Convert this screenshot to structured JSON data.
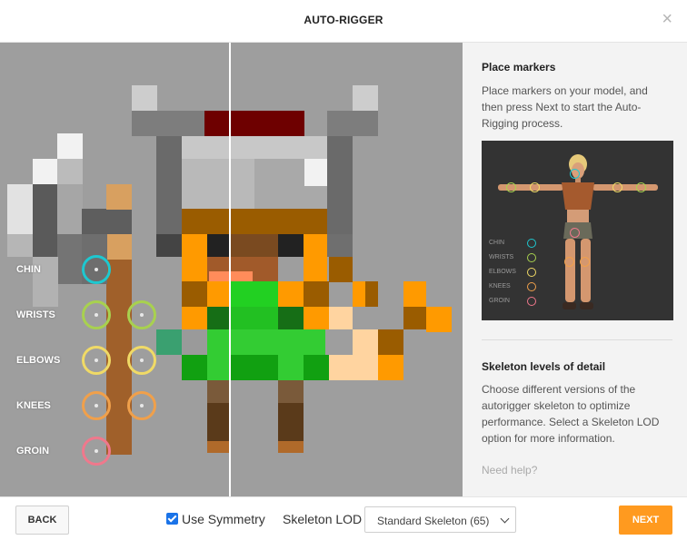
{
  "title": "AUTO-RIGGER",
  "close_label": "×",
  "markers": {
    "items": [
      {
        "label": "CHIN",
        "color": "#1ec8d0",
        "count": 1
      },
      {
        "label": "WRISTS",
        "color": "#a8d14f",
        "count": 2
      },
      {
        "label": "ELBOWS",
        "color": "#f0da66",
        "count": 2
      },
      {
        "label": "KNEES",
        "color": "#f0a04b",
        "count": 2
      },
      {
        "label": "GROIN",
        "color": "#f0788c",
        "count": 1
      }
    ]
  },
  "sidebar": {
    "place_heading": "Place markers",
    "place_text": "Place markers on your model, and then press Next to start the Auto-Rigging process.",
    "preview_legend": [
      "CHIN",
      "WRISTS",
      "ELBOWS",
      "KNEES",
      "GROIN"
    ],
    "lod_heading": "Skeleton levels of detail",
    "lod_text": "Choose different versions of the autorigger skeleton to optimize performance. Select a Skeleton LOD option for more information.",
    "help": "Need help?"
  },
  "footer": {
    "back": "BACK",
    "symmetry_label": "Use Symmetry",
    "symmetry_checked": true,
    "lod_label": "Skeleton LOD",
    "lod_value": "Standard Skeleton (65)",
    "next": "NEXT"
  }
}
